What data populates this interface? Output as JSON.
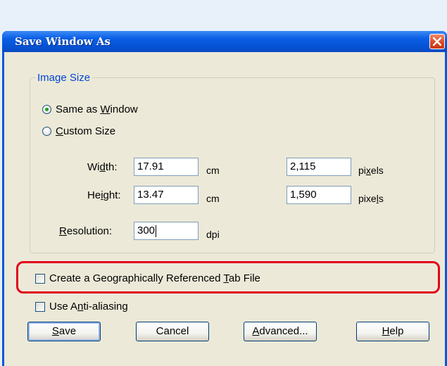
{
  "window": {
    "title": "Save Window As"
  },
  "image_size": {
    "group_title": "Image Size",
    "same_as_window": {
      "pre": "Same as ",
      "accel": "W",
      "post": "indow",
      "checked": true
    },
    "custom_size": {
      "pre": "",
      "accel": "C",
      "post": "ustom Size",
      "checked": false
    },
    "width": {
      "label_pre": "Wi",
      "label_accel": "d",
      "label_post": "th:",
      "value_cm": "17.91",
      "unit_cm": "cm",
      "value_px": "2,115",
      "unit_px_pre": "pi",
      "unit_px_accel": "x",
      "unit_px_post": "els"
    },
    "height": {
      "label_pre": "He",
      "label_accel": "i",
      "label_post": "ght:",
      "value_cm": "13.47",
      "unit_cm": "cm",
      "value_px": "1,590",
      "unit_px_pre": "pixe",
      "unit_px_accel": "l",
      "unit_px_post": "s"
    },
    "resolution": {
      "label_pre": "",
      "label_accel": "R",
      "label_post": "esolution:",
      "value": "300",
      "unit": "dpi"
    }
  },
  "options": {
    "geo_tab": {
      "pre": "Create a Geographically Referenced ",
      "accel": "T",
      "post": "ab File",
      "checked": false
    },
    "anti_alias": {
      "pre": "Use A",
      "accel": "n",
      "post": "ti-aliasing",
      "checked": false
    }
  },
  "buttons": {
    "save": {
      "pre": "",
      "accel": "S",
      "post": "ave"
    },
    "cancel": {
      "pre": "Cancel",
      "accel": "",
      "post": ""
    },
    "advanced": {
      "pre": "",
      "accel": "A",
      "post": "dvanced..."
    },
    "help": {
      "pre": "",
      "accel": "H",
      "post": "elp"
    }
  },
  "colors": {
    "highlight": "#e0001b",
    "title_bar": "#0553d6",
    "group_title": "#0046d5"
  }
}
